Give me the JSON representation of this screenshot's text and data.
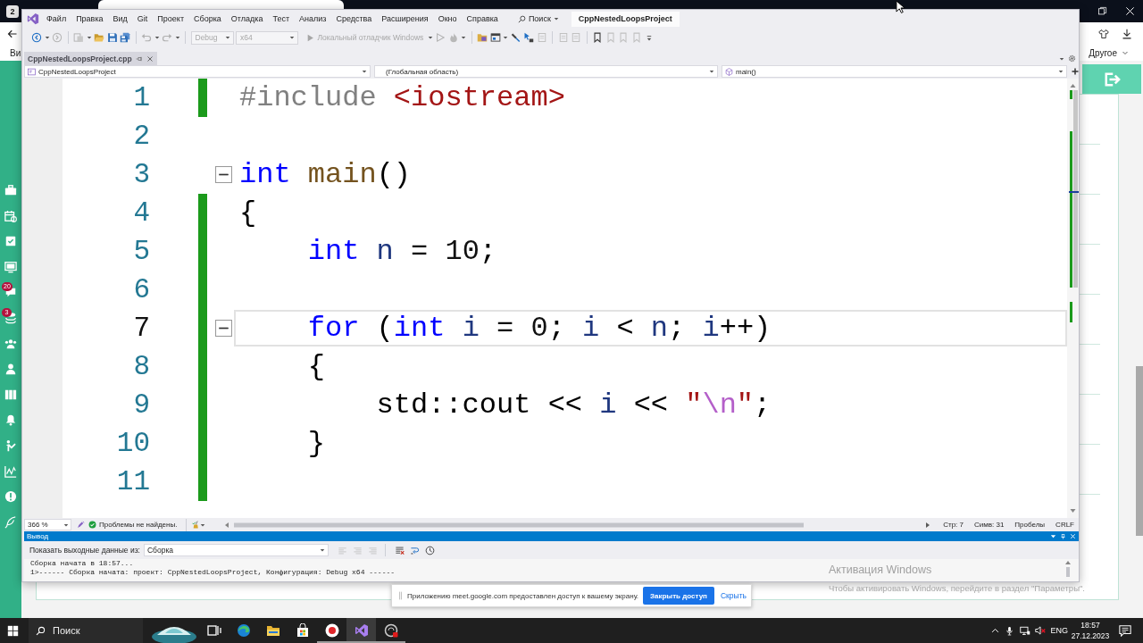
{
  "browser": {
    "workspace_badge": "2",
    "partial_label": "Ви",
    "bookmarks_menu": "Другое",
    "sidebar_badges": [
      "20",
      "3"
    ]
  },
  "ide": {
    "menu": [
      "Файл",
      "Правка",
      "Вид",
      "Git",
      "Проект",
      "Сборка",
      "Отладка",
      "Тест",
      "Анализ",
      "Средства",
      "Расширения",
      "Окно",
      "Справка"
    ],
    "search": "Поиск",
    "solution_title": "CppNestedLoopsProject",
    "toolbar": {
      "configuration": "Debug",
      "platform": "x64",
      "debugger": "Локальный отладчик Windows",
      "disabled": true
    },
    "document_tab": {
      "label": "CppNestedLoopsProject.cpp",
      "selected": true
    },
    "navigation": {
      "project": "CppNestedLoopsProject",
      "scope": "(Глобальная область)",
      "member": "main()"
    },
    "editor": {
      "lines": [
        {
          "number": "1",
          "changed": true,
          "collapsible": false,
          "current": false,
          "tokens": [
            {
              "text": "#include",
              "kind": "preprocessor"
            },
            {
              "text": " <iostream>",
              "kind": "string"
            }
          ]
        },
        {
          "number": "2",
          "changed": false,
          "collapsible": false,
          "current": false
        },
        {
          "number": "3",
          "changed": false,
          "collapsible": true,
          "current": false,
          "tokens": [
            {
              "text": "int",
              "kind": "keyword"
            },
            {
              "text": " main",
              "kind": "function"
            },
            {
              "text": "()",
              "kind": "plain"
            }
          ]
        },
        {
          "number": "4",
          "changed": true,
          "collapsible": false,
          "current": false,
          "tokens": [
            {
              "text": "{",
              "kind": "plain"
            }
          ],
          "children": [
            {
              "number": "5",
              "changed": true,
              "collapsible": false,
              "current": false,
              "tokens": [
                {
                  "text": "int",
                  "kind": "keyword"
                },
                {
                  "text": " n",
                  "kind": "variable"
                },
                {
                  "text": " = ",
                  "kind": "plain"
                },
                {
                  "text": "10",
                  "kind": "number"
                },
                {
                  "text": ";",
                  "kind": "plain"
                }
              ]
            },
            {
              "number": "6",
              "changed": true,
              "collapsible": false,
              "current": false
            },
            {
              "number": "7",
              "changed": true,
              "collapsible": true,
              "current": true,
              "tokens": [
                {
                  "text": "for",
                  "kind": "keyword"
                },
                {
                  "text": " (",
                  "kind": "plain"
                },
                {
                  "text": "int",
                  "kind": "keyword"
                },
                {
                  "text": " i",
                  "kind": "variable"
                },
                {
                  "text": " = ",
                  "kind": "plain"
                },
                {
                  "text": "0",
                  "kind": "number"
                },
                {
                  "text": ";",
                  "kind": "plain"
                },
                {
                  "text": " i",
                  "kind": "variable"
                },
                {
                  "text": " < ",
                  "kind": "plain"
                },
                {
                  "text": "n",
                  "kind": "variable"
                },
                {
                  "text": ";",
                  "kind": "plain"
                },
                {
                  "text": " i",
                  "kind": "variable"
                },
                {
                  "text": "++)",
                  "kind": "plain"
                }
              ]
            },
            {
              "number": "8",
              "changed": true,
              "collapsible": false,
              "current": false,
              "tokens": [
                {
                  "text": "{",
                  "kind": "plain"
                }
              ],
              "children": [
                {
                  "number": "9",
                  "changed": true,
                  "collapsible": false,
                  "current": false,
                  "tokens": [
                    {
                      "text": "std::cout << ",
                      "kind": "plain"
                    },
                    {
                      "text": "i",
                      "kind": "variable"
                    },
                    {
                      "text": " << ",
                      "kind": "plain"
                    },
                    {
                      "text": "\"",
                      "kind": "string"
                    },
                    {
                      "text": "\\n",
                      "kind": "escape"
                    },
                    {
                      "text": "\"",
                      "kind": "string"
                    },
                    {
                      "text": ";",
                      "kind": "plain"
                    }
                  ]
                }
              ]
            },
            {
              "number": "10",
              "changed": true,
              "collapsible": false,
              "current": false,
              "tokens": [
                {
                  "text": "}",
                  "kind": "plain"
                }
              ]
            }
          ]
        },
        {
          "number": "11",
          "changed": true,
          "collapsible": false,
          "current": false
        }
      ]
    },
    "status": {
      "zoom": "366 %",
      "issues": "Проблемы не найдены.",
      "line": "Стр: 7",
      "column": "Симв: 31",
      "indentation": "Пробелы",
      "line_endings": "CRLF"
    },
    "output": {
      "title": "Вывод",
      "source_label": "Показать выходные данные из:",
      "source": "Сборка",
      "lines": [
        "Сборка начата в 18:57...",
        "1>------ Сборка начата: проект: CppNestedLoopsProject, Конфигурация: Debug x64 ------"
      ]
    }
  },
  "screen_share_notice": {
    "message": "Приложению meet.google.com предоставлен доступ к вашему экрану.",
    "stop_button": "Закрыть доступ",
    "hide_link": "Скрыть"
  },
  "activation_notice": {
    "title": "Активация Windows",
    "hint": "Чтобы активировать Windows, перейдите в раздел \"Параметры\"."
  },
  "taskbar": {
    "search": {
      "placeholder": "Поиск"
    },
    "apps": [
      {
        "selected": false,
        "running": false
      },
      {
        "selected": false,
        "running": false
      },
      {
        "selected": false,
        "running": false
      },
      {
        "selected": false,
        "running": true
      },
      {
        "selected": true,
        "running": true
      },
      {
        "selected": false,
        "running": true
      }
    ],
    "volume": {
      "muted": true
    },
    "language": "ENG",
    "time": "18:57",
    "date": "27.12.2023"
  }
}
